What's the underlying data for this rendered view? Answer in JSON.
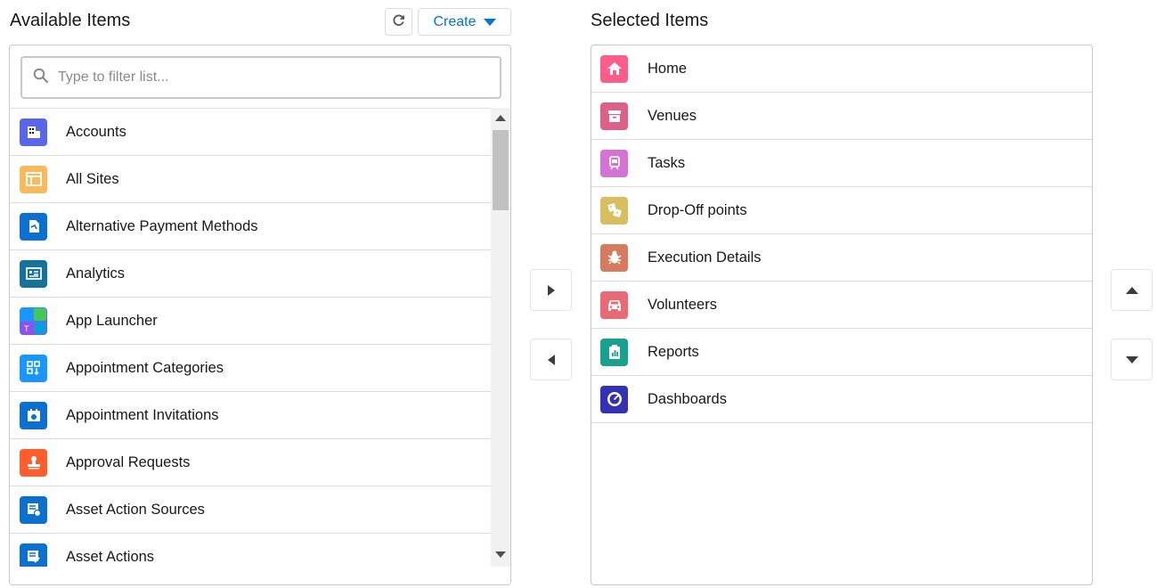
{
  "available": {
    "title": "Available Items",
    "create_label": "Create",
    "search_placeholder": "Type to filter list...",
    "items": [
      {
        "label": "Accounts",
        "icon": "accounts-icon",
        "color": "#5867e8"
      },
      {
        "label": "All Sites",
        "icon": "all-sites-icon",
        "color": "#fcb95b"
      },
      {
        "label": "Alternative Payment Methods",
        "icon": "payment-method-icon",
        "color": "#0b70ce"
      },
      {
        "label": "Analytics",
        "icon": "analytics-icon",
        "color": "#14729b"
      },
      {
        "label": "App Launcher",
        "icon": "app-launcher-icon",
        "color": "#7d7ee8"
      },
      {
        "label": "Appointment Categories",
        "icon": "appointment-categories-icon",
        "color": "#1b96ff"
      },
      {
        "label": "Appointment Invitations",
        "icon": "appointment-invitations-icon",
        "color": "#0b70ce"
      },
      {
        "label": "Approval Requests",
        "icon": "approval-icon",
        "color": "#ff5d2d"
      },
      {
        "label": "Asset Action Sources",
        "icon": "asset-action-source-icon",
        "color": "#0b70ce"
      },
      {
        "label": "Asset Actions",
        "icon": "asset-action-icon",
        "color": "#0b70ce"
      }
    ]
  },
  "selected": {
    "title": "Selected Items",
    "items": [
      {
        "label": "Home",
        "icon": "home-icon",
        "color": "#fe5c8a"
      },
      {
        "label": "Venues",
        "icon": "venues-icon",
        "color": "#dd6087"
      },
      {
        "label": "Tasks",
        "icon": "tasks-icon",
        "color": "#d473d4"
      },
      {
        "label": "Drop-Off points",
        "icon": "drop-off-icon",
        "color": "#d8be5f"
      },
      {
        "label": "Execution Details",
        "icon": "bug-icon",
        "color": "#d57c5f"
      },
      {
        "label": "Volunteers",
        "icon": "car-icon",
        "color": "#e96974"
      },
      {
        "label": "Reports",
        "icon": "report-icon",
        "color": "#17a18e"
      },
      {
        "label": "Dashboards",
        "icon": "dashboard-icon",
        "color": "#3431b4"
      }
    ]
  },
  "colors": {
    "accent": "#0176d3"
  }
}
